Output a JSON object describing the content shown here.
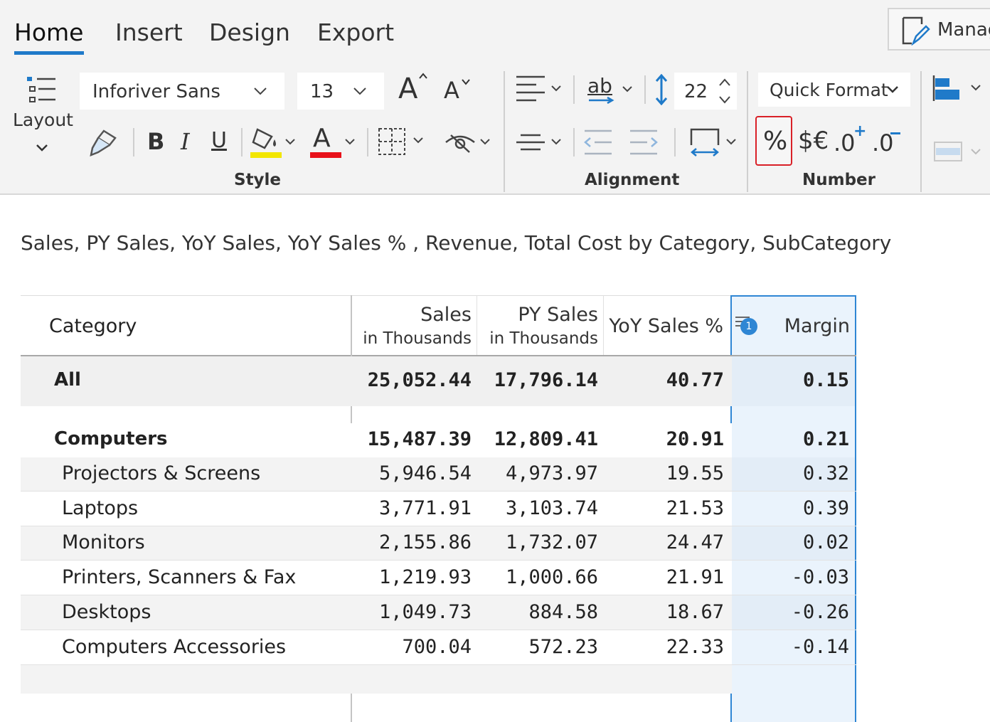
{
  "tabs": [
    {
      "label": "Home",
      "active": true
    },
    {
      "label": "Insert"
    },
    {
      "label": "Design"
    },
    {
      "label": "Export"
    }
  ],
  "manage_button": {
    "label": "Manag"
  },
  "ribbon": {
    "layout_label": "Layout",
    "font_name": "Inforiver Sans",
    "font_size": "13",
    "bold": "B",
    "italic": "I",
    "underline": "U",
    "font_color_letter": "A",
    "ab_label": "ab",
    "line_height": "22",
    "quick_format": "Quick Format",
    "percent": "%",
    "currency": "$€",
    "decimals_increase": ".0",
    "decimals_decrease": ".0",
    "groups": {
      "style": "Style",
      "alignment": "Alignment",
      "number": "Number"
    },
    "colors": {
      "accent": "#1f7ac9",
      "highlight": "#f2e600",
      "font_color": "#e8101a",
      "selection_border": "#d92027"
    }
  },
  "report_title": "Sales, PY Sales, YoY Sales, YoY Sales % , Revenue, Total Cost by Category, SubCategory",
  "table": {
    "headers": {
      "category": "Category",
      "sales": "Sales",
      "sales_sub": "in Thousands",
      "py_sales": "PY Sales",
      "py_sales_sub": "in Thousands",
      "yoy": "YoY Sales %",
      "margin": "Margin",
      "margin_badge": "1"
    },
    "rows": [
      {
        "label": "All",
        "sales": "25,052.44",
        "py": "17,796.14",
        "yoy": "40.77",
        "margin": "0.15",
        "bold": true
      },
      {
        "label": "Computers",
        "sales": "15,487.39",
        "py": "12,809.41",
        "yoy": "20.91",
        "margin": "0.21",
        "bold": true
      },
      {
        "label": "Projectors & Screens",
        "sales": "5,946.54",
        "py": "4,973.97",
        "yoy": "19.55",
        "margin": "0.32"
      },
      {
        "label": "Laptops",
        "sales": "3,771.91",
        "py": "3,103.74",
        "yoy": "21.53",
        "margin": "0.39"
      },
      {
        "label": "Monitors",
        "sales": "2,155.86",
        "py": "1,732.07",
        "yoy": "24.47",
        "margin": "0.02"
      },
      {
        "label": "Printers, Scanners & Fax",
        "sales": "1,219.93",
        "py": "1,000.66",
        "yoy": "21.91",
        "margin": "-0.03"
      },
      {
        "label": "Desktops",
        "sales": "1,049.73",
        "py": "884.58",
        "yoy": "18.67",
        "margin": "-0.26"
      },
      {
        "label": "Computers Accessories",
        "sales": "700.04",
        "py": "572.23",
        "yoy": "22.33",
        "margin": "-0.14"
      }
    ]
  }
}
